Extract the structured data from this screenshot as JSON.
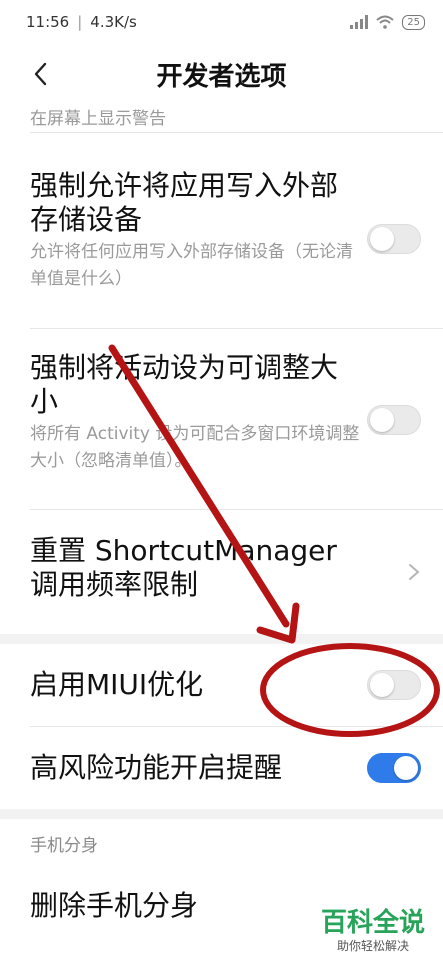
{
  "status_bar": {
    "time": "11:56",
    "separator": "|",
    "speed": "4.3K/s",
    "battery": "25"
  },
  "header": {
    "title": "开发者选项"
  },
  "partial_desc": "在屏幕上显示警告",
  "items": [
    {
      "title": "强制允许将应用写入外部存储设备",
      "desc": "允许将任何应用写入外部存储设备（无论清单值是什么）",
      "toggle": "off"
    },
    {
      "title": "强制将活动设为可调整大小",
      "desc": "将所有 Activity 设为可配合多窗口环境调整大小（忽略清单值）。",
      "toggle": "off"
    },
    {
      "title": "重置 ShortcutManager 调用频率限制",
      "control": "chevron"
    },
    {
      "title": "启用MIUI优化",
      "toggle": "off"
    },
    {
      "title": "高风险功能开启提醒",
      "toggle": "on"
    }
  ],
  "section": {
    "header": "手机分身"
  },
  "delete_item": {
    "title": "删除手机分身"
  },
  "watermark": {
    "title": "百科全说",
    "subtitle": "助你轻松解决"
  },
  "colors": {
    "toggle_on": "#2f7bea",
    "annotation": "#b51414",
    "watermark": "#27a35a"
  },
  "icons": {
    "back": "back-arrow-icon",
    "chevron": "chevron-right-icon",
    "signal": "signal-icon",
    "wifi": "wifi-icon"
  }
}
